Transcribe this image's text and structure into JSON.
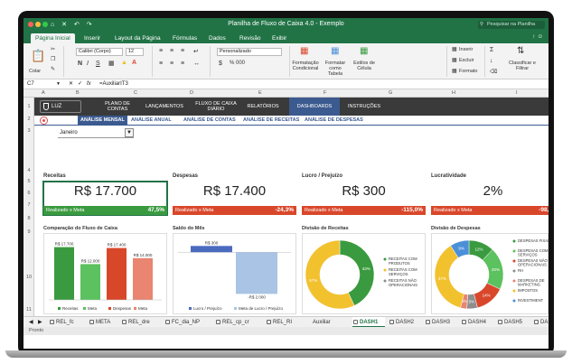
{
  "window": {
    "title": "Planilha de Fluxo de Caixa 4.0 - Exemplo",
    "search_placeholder": "Pesquisar na Planilha"
  },
  "ribbon_tabs": [
    {
      "label": "Página Inicial",
      "active": true
    },
    {
      "label": "Inserir"
    },
    {
      "label": "Layout da Página"
    },
    {
      "label": "Fórmulas"
    },
    {
      "label": "Dados"
    },
    {
      "label": "Revisão"
    },
    {
      "label": "Exibir"
    }
  ],
  "ribbon": {
    "paste_label": "Colar",
    "font_name": "Calibri (Corpo)",
    "font_size": "12",
    "number_format": "Personalizado",
    "number_symbols": "% 000",
    "conditional_format_label": "Formatação Condicional",
    "format_table_label": "Formatar como Tabela",
    "cell_styles_label": "Estilos de Célula",
    "insert_label": "Inserir",
    "delete_label": "Excluir",
    "format_label": "Formato",
    "sort_filter_label": "Classificar e Filtrar",
    "bold": "N",
    "italic": "I",
    "underline": "S"
  },
  "formula_bar": {
    "cell_ref": "C7",
    "fx": "fx",
    "formula": "=AuxiliarIT3"
  },
  "columns": [
    "A",
    "B",
    "C",
    "D",
    "E",
    "F",
    "G",
    "H",
    "I"
  ],
  "rows": [
    "1",
    "2",
    "3",
    "4",
    "5",
    "6",
    "7",
    "8",
    "9",
    "10",
    "11"
  ],
  "nav": {
    "logo": "LUZ",
    "items": [
      {
        "label": "PLANO DE CONTAS"
      },
      {
        "label": "LANÇAMENTOS"
      },
      {
        "label": "FLUXO DE CAIXA DIÁRIO"
      },
      {
        "label": "RELATÓRIOS"
      },
      {
        "label": "DASHBOARDS",
        "active": true
      },
      {
        "label": "INSTRUÇÕES"
      }
    ]
  },
  "subnav": [
    {
      "label": "ANÁLISE MENSAL",
      "active": true
    },
    {
      "label": "ANÁLISE ANUAL"
    },
    {
      "label": "ANÁLISE DE CONTAS"
    },
    {
      "label": "ANÁLISE DE RECEITAS"
    },
    {
      "label": "ANÁLISE DE DESPESAS"
    }
  ],
  "month_select": "Janeiro",
  "kpis": [
    {
      "label": "Receitas",
      "value": "R$ 17.700",
      "bar_label": "Realizado x Meta",
      "pct": "47,5%",
      "color": "#3a9a3f"
    },
    {
      "label": "Despesas",
      "value": "R$ 17.400",
      "bar_label": "Realizado x Meta",
      "pct": "-24,3%",
      "color": "#d9472b"
    },
    {
      "label": "Lucro / Prejuízo",
      "value": "R$ 300",
      "bar_label": "Realizado x Meta",
      "pct": "-115,0%",
      "color": "#d9472b"
    },
    {
      "label": "Lucratividade",
      "value": "2%",
      "bar_label": "Realizado x Meta",
      "pct": "-98,5",
      "color": "#d9472b"
    }
  ],
  "charts": {
    "comparacao": {
      "title": "Comparação do Fluxo de Caixa",
      "legend": [
        "Receitas",
        "Meta",
        "Despesas",
        "Meta"
      ],
      "colors": [
        "#3a9a3f",
        "#5cc15f",
        "#d9472b",
        "#e98570"
      ]
    },
    "saldo": {
      "title": "Saldo do Mês",
      "legend": [
        "Lucro / Prejuízo",
        "Meta de Lucro / Prejuízo"
      ],
      "colors": [
        "#4b6bbf",
        "#a9c4e4"
      ]
    },
    "receitas": {
      "title": "Divisão de Receitas",
      "legend": [
        "RECEITAS COM PRODUTOS",
        "RECEITAS COM SERVIÇOS",
        "RECEITAS NÃO OPERACIONAIS"
      ],
      "colors": [
        "#3a9a3f",
        "#f2c12e",
        "#8e8e8e"
      ]
    },
    "despesas": {
      "title": "Divisão de Despesas",
      "legend": [
        "DESPESAS FIXAS",
        "DESPESAS COM SERVIÇOS",
        "DESPESAS NÃO OPERACIONAIS",
        "RH",
        "DESPESAS DE MARKETING",
        "IMPOSTOS",
        "INVESTIMENT"
      ]
    }
  },
  "chart_data": [
    {
      "type": "bar",
      "title": "Comparação do Fluxo de Caixa",
      "categories": [
        "Receitas",
        "Meta",
        "Despesas",
        "Meta"
      ],
      "values": [
        17700,
        12000,
        17400,
        14000
      ],
      "labels": [
        "R$ 17.700",
        "R$ 12.000",
        "R$ 17.400",
        "R$ 14.000"
      ],
      "ylim": [
        0,
        20000
      ]
    },
    {
      "type": "bar",
      "title": "Saldo do Mês",
      "categories": [
        "Lucro / Prejuízo",
        "Meta de Lucro / Prejuízo"
      ],
      "values": [
        300,
        -2000
      ],
      "labels": [
        "R$ 300",
        "-R$ 2.000"
      ],
      "ylim": [
        -2200,
        400
      ]
    },
    {
      "type": "pie",
      "title": "Divisão de Receitas",
      "categories": [
        "RECEITAS COM PRODUTOS",
        "RECEITAS COM SERVIÇOS",
        "RECEITAS NÃO OPERACIONAIS"
      ],
      "values": [
        43,
        57,
        0
      ],
      "labels": [
        "43%",
        "57%",
        "0%"
      ],
      "colors": [
        "#3a9a3f",
        "#f2c12e",
        "#8e8e8e"
      ]
    },
    {
      "type": "pie",
      "title": "Divisão de Despesas",
      "categories": [
        "DESPESAS FIXAS",
        "DESPESAS COM SERVIÇOS",
        "DESPESAS NÃO OPERACIONAIS",
        "RH",
        "DESPESAS DE MARKETING",
        "IMPOSTOS",
        "INVESTIMENT"
      ],
      "values": [
        12,
        20,
        14,
        5,
        3,
        37,
        9
      ],
      "labels": [
        "12%",
        "20%",
        "14%",
        "5%",
        "3%",
        "37%",
        "9%"
      ],
      "colors": [
        "#3a9a3f",
        "#5cc15f",
        "#d9472b",
        "#8e8e8e",
        "#e98570",
        "#f2c12e",
        "#4b8fd8"
      ]
    }
  ],
  "sheets": [
    {
      "label": "REL_fc",
      "locked": true
    },
    {
      "label": "META",
      "locked": true
    },
    {
      "label": "REL_dre",
      "locked": true
    },
    {
      "label": "FC_dia_NP",
      "locked": true
    },
    {
      "label": "REL_cp_cr",
      "locked": true
    },
    {
      "label": "REL_RI",
      "locked": true
    },
    {
      "label": "Auxiliar",
      "locked": false
    },
    {
      "label": "DASH1",
      "locked": true,
      "active": true
    },
    {
      "label": "DASH2",
      "locked": true
    },
    {
      "label": "DASH3",
      "locked": true
    },
    {
      "label": "DASH4",
      "locked": true
    },
    {
      "label": "DASH5",
      "locked": true
    },
    {
      "label": "DASH6",
      "locked": true
    }
  ],
  "status": "Pronto"
}
